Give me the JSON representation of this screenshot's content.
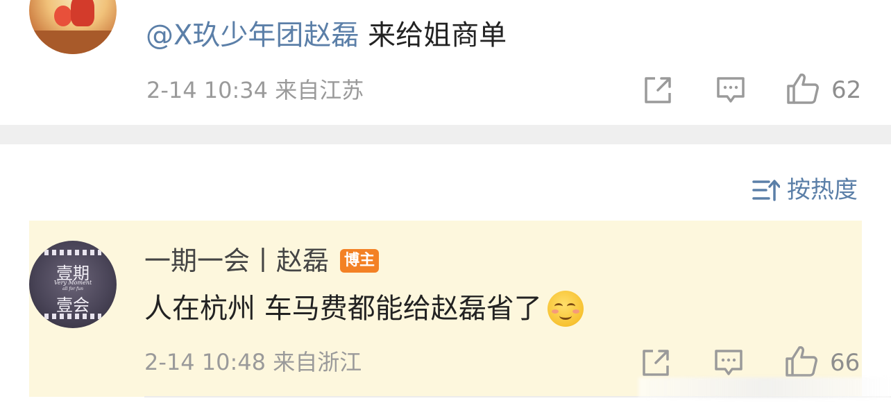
{
  "comment1": {
    "mention": "@X玖少年团赵磊",
    "text": "来给姐商单",
    "meta": "2-14 10:34 来自江苏",
    "likes": "62"
  },
  "sort": {
    "label": "按热度"
  },
  "comment2": {
    "author": "一期一会丨赵磊",
    "badge": "博主",
    "text": "人在杭州 车马费都能给赵磊省了",
    "meta": "2-14 10:48 来自浙江",
    "likes": "66",
    "avatar_text": {
      "top": "壹期",
      "small1": "Very Moment",
      "small2": "all for fun",
      "bottom": "壹会"
    }
  },
  "colors": {
    "mention": "#5b7fa8",
    "highlight_bg": "#fdf7dd",
    "badge": "#f38125",
    "meta_text": "#9a9a9a",
    "divider": "#efefef"
  },
  "icons": [
    "repost-icon",
    "comment-icon",
    "like-icon",
    "sort-icon",
    "smile-emoji"
  ]
}
